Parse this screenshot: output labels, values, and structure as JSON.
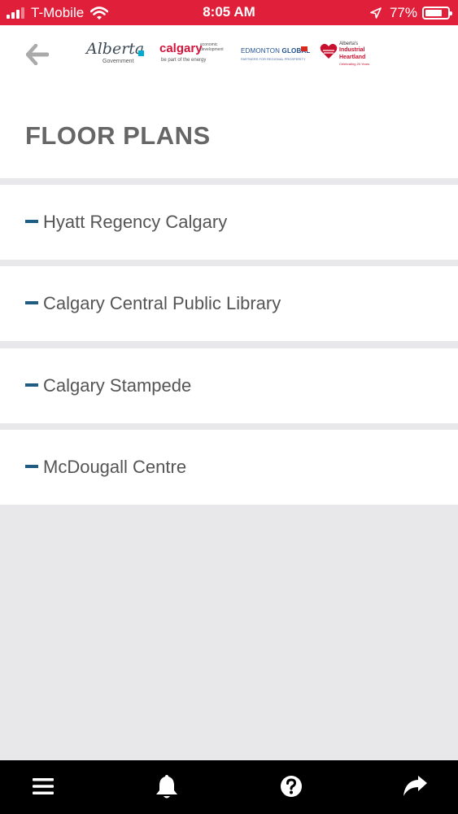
{
  "status_bar": {
    "carrier": "T-Mobile",
    "time": "8:05 AM",
    "battery_percent": "77%",
    "battery_level": 0.77,
    "icons": [
      "signal-icon",
      "wifi-icon",
      "location-arrow-icon",
      "battery-icon"
    ]
  },
  "header": {
    "back_icon": "back-arrow-icon",
    "logos": {
      "alberta": {
        "script": "Alberta",
        "sub": "Government"
      },
      "calgary": {
        "main": "calgary",
        "side": "economic development",
        "tagline": "be part of the energy"
      },
      "edmonton": {
        "name_regular": "EDMONTON ",
        "name_bold": "GLOBAL",
        "sub": "PARTNERS FOR REGIONAL PROSPERITY"
      },
      "heartland": {
        "line1": "Alberta's",
        "line2": "Industrial",
        "line3": "Heartland",
        "line4": "Celebrating 20 Years"
      }
    }
  },
  "page_title": "FLOOR PLANS",
  "floor_plans": [
    {
      "label": "Hyatt Regency Calgary"
    },
    {
      "label": "Calgary Central Public Library"
    },
    {
      "label": "Calgary Stampede"
    },
    {
      "label": "McDougall Centre"
    }
  ],
  "bottom_nav": {
    "items": [
      {
        "icon": "menu-icon"
      },
      {
        "icon": "bell-icon"
      },
      {
        "icon": "help-icon"
      },
      {
        "icon": "share-icon"
      }
    ]
  },
  "colors": {
    "status_bar": "#e0203a",
    "accent_dash": "#1f5c82",
    "page_background": "#e8e8ea",
    "bottom_nav": "#000000"
  }
}
